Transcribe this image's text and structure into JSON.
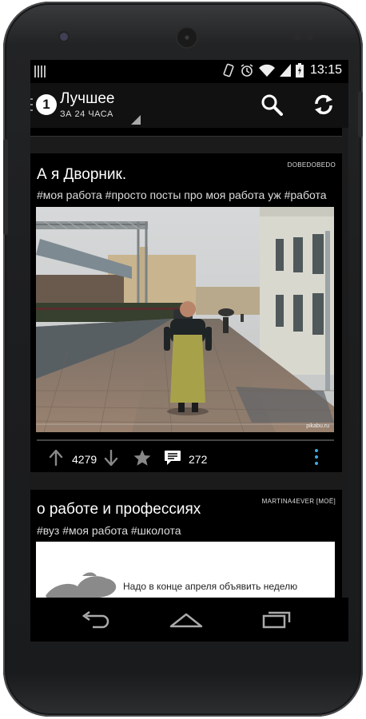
{
  "status_bar": {
    "time": "13:15",
    "icons": [
      "notification-icon",
      "screen-rotation-icon",
      "alarm-icon",
      "wifi-icon",
      "signal-icon",
      "battery-icon"
    ]
  },
  "action_bar": {
    "badge": "1",
    "title": "Лучшее",
    "subtitle": "ЗА 24 ЧАСА"
  },
  "posts": [
    {
      "author": "DOBEDOBEDO",
      "title": "А я Дворник.",
      "tags": "#моя работа #просто посты про моя работа уж #работа",
      "image_watermark": "pikabu.ru",
      "rating": "4279",
      "comments": "272"
    },
    {
      "author": "MARTINA4EVER [МОЁ]",
      "title": "о работе и профессиях",
      "tags": "#вуз #моя работа #школота",
      "image_text": "Надо в конце апреля объявить неделю"
    }
  ],
  "colors": {
    "accent": "#3aa6df",
    "card_background": "#000000",
    "screen_background": "#1b1b1b"
  }
}
